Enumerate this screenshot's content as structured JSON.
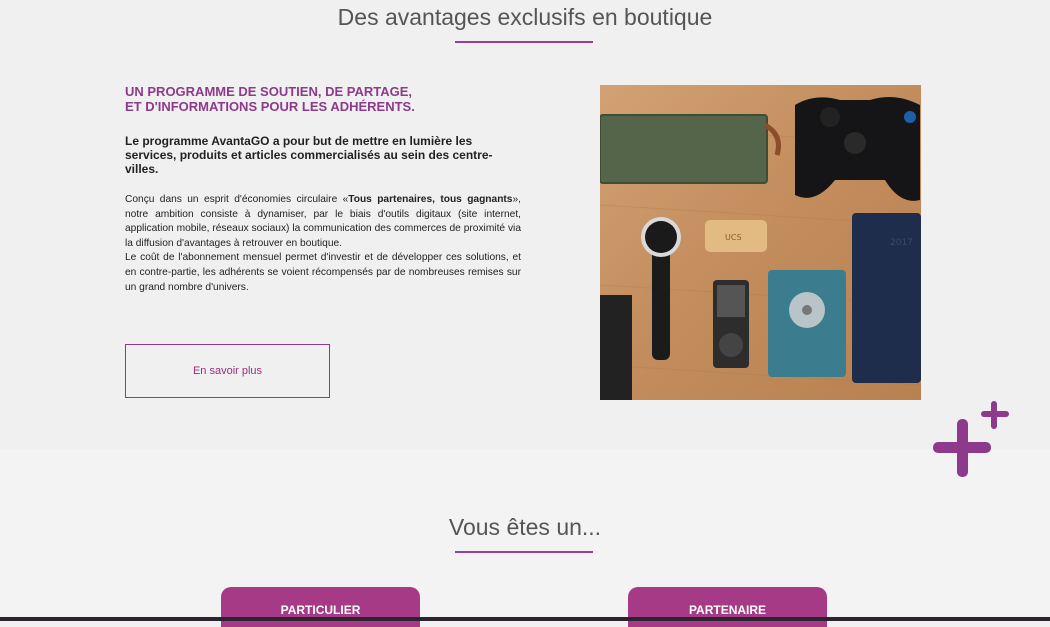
{
  "advantages": {
    "title": "Des avantages exclusifs en boutique",
    "lead_line1": "UN PROGRAMME DE SOUTIEN, DE PARTAGE,",
    "lead_line2": "ET D'INFORMATIONS POUR LES ADHÉRENTS.",
    "intro": "Le programme AvantaGO a pour but de mettre en lumière les services, produits et articles commercialisés au sein des centre-villes.",
    "body_part1": "Conçu dans un esprit d'économies circulaire «",
    "body_bold": "Tous partenaires, tous gagnants",
    "body_part2": "», notre ambition consiste à dynamiser, par le biais d'outils digitaux (site internet, application mobile, réseaux sociaux) la communication des commerces de proximité via la diffusion d'avantages à retrouver en boutique.",
    "body_line2": "Le coût de l'abonnement mensuel permet d'investir et de développer ces solutions, et en contre-partie, les adhérents se voient récompensés par de nombreuses remises sur un grand nombre d'univers.",
    "cta_label": "En savoir plus",
    "photo_usb_text": "UCS",
    "photo_notebook_text": "2017"
  },
  "audience": {
    "title": "Vous êtes un...",
    "buttons": [
      {
        "label": "PARTICULIER"
      },
      {
        "label": "PARTENAIRE"
      }
    ]
  },
  "colors": {
    "accent": "#8e3a8c",
    "button_bg": "#a63a87",
    "heading": "#555555"
  },
  "icons": {
    "decoration": "plus-icon"
  }
}
